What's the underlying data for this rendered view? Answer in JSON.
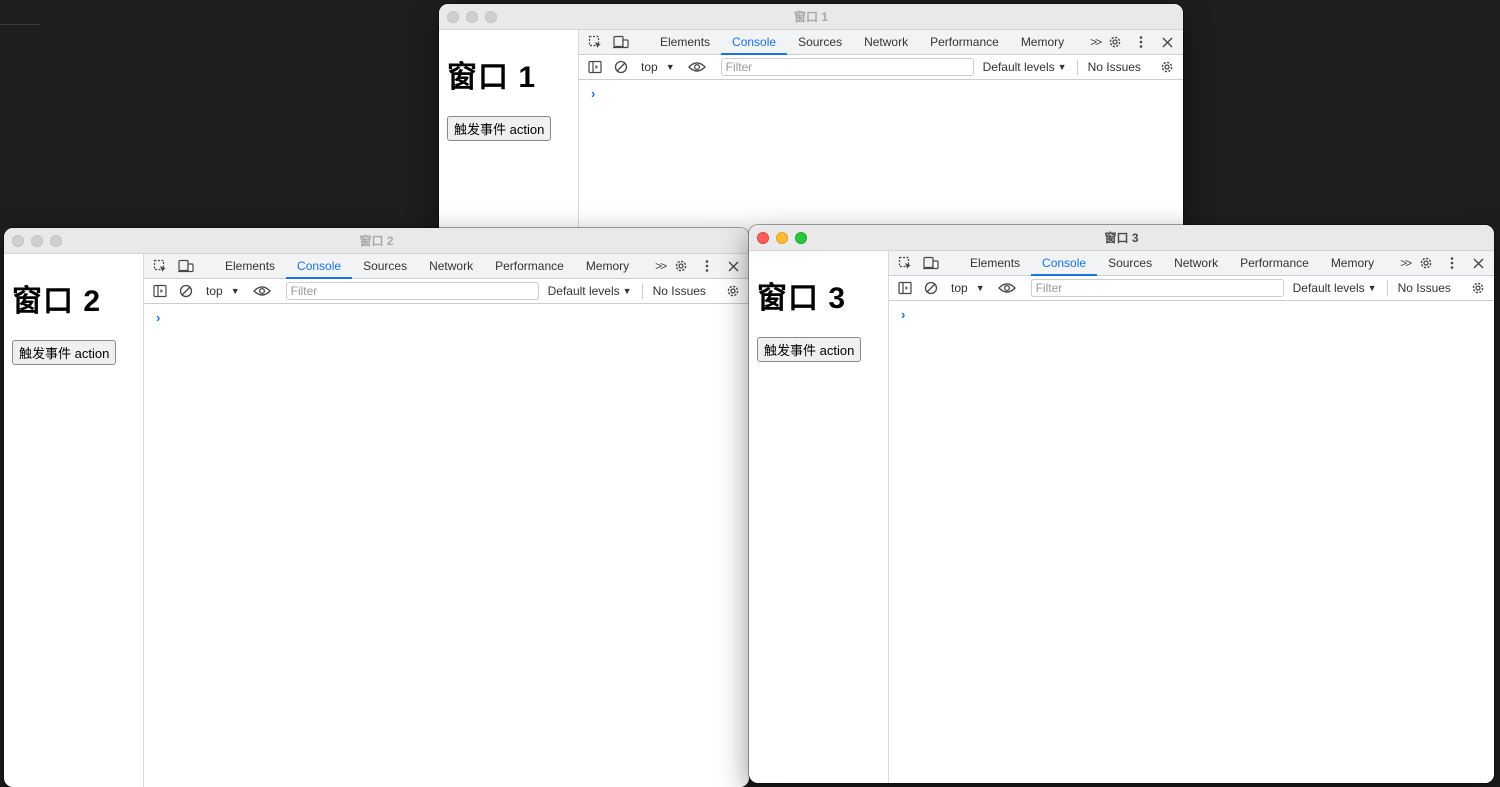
{
  "windows": [
    {
      "title": "窗口 1",
      "heading": "窗口 1",
      "button_label": "触发事件 action",
      "active": false
    },
    {
      "title": "窗口 2",
      "heading": "窗口 2",
      "button_label": "触发事件 action",
      "active": false
    },
    {
      "title": "窗口 3",
      "heading": "窗口 3",
      "button_label": "触发事件 action",
      "active": true
    }
  ],
  "devtools": {
    "tabs": [
      "Elements",
      "Console",
      "Sources",
      "Network",
      "Performance",
      "Memory"
    ],
    "selected_tab": "Console",
    "more_tabs": ">>",
    "context": "top",
    "filter_placeholder": "Filter",
    "levels": "Default levels",
    "issues": "No Issues",
    "prompt": "›"
  },
  "colors": {
    "accent": "#1a73e8",
    "traffic_red": "#ff5f57",
    "traffic_yellow": "#febc2e",
    "traffic_green": "#28c840"
  },
  "icons": {
    "inspect": "inspect-element-icon",
    "device": "device-toolbar-icon",
    "sidebar": "sidebar-toggle-icon",
    "clear": "clear-console-icon",
    "eye": "live-expression-eye-icon",
    "gear": "gear-icon",
    "kebab": "kebab-menu-icon",
    "close": "close-icon"
  }
}
